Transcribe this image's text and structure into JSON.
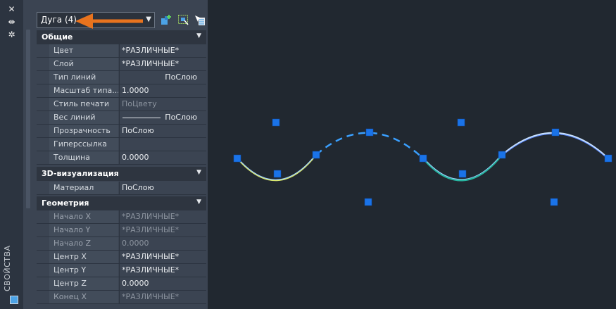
{
  "palette": {
    "vertical_title": "СВОЙСТВА",
    "selector_value": "Дуга (4)",
    "sections": {
      "general": "Общие",
      "visual3d": "3D-визуализация",
      "geometry": "Геометрия"
    },
    "general_rows": [
      {
        "name": "Цвет",
        "value": "*РАЗЛИЧНЫЕ*"
      },
      {
        "name": "Слой",
        "value": "*РАЗЛИЧНЫЕ*"
      },
      {
        "name": "Тип линий",
        "value": "ПоСлою"
      },
      {
        "name": "Масштаб типа...",
        "value": "1.0000"
      },
      {
        "name": "Стиль печати",
        "value": "ПоЦвету"
      },
      {
        "name": "Вес линий",
        "value": "ПоСлою"
      },
      {
        "name": "Прозрачность",
        "value": "ПоСлою"
      },
      {
        "name": "Гиперссылка",
        "value": ""
      },
      {
        "name": "Толщина",
        "value": "0.0000"
      }
    ],
    "visual_rows": [
      {
        "name": "Материал",
        "value": "ПоСлою"
      }
    ],
    "geometry_rows": [
      {
        "name": "Начало X",
        "value": "*РАЗЛИЧНЫЕ*"
      },
      {
        "name": "Начало Y",
        "value": "*РАЗЛИЧНЫЕ*"
      },
      {
        "name": "Начало Z",
        "value": "0.0000"
      },
      {
        "name": "Центр X",
        "value": "*РАЗЛИЧНЫЕ*"
      },
      {
        "name": "Центр Y",
        "value": "*РАЗЛИЧНЫЕ*"
      },
      {
        "name": "Центр Z",
        "value": "0.0000"
      },
      {
        "name": "Конец X",
        "value": "*РАЗЛИЧНЫЕ*"
      }
    ]
  },
  "icons": {
    "close": "close-icon",
    "autohide": "autohide-icon",
    "settings": "settings-icon",
    "quick_select": "quick-select-icon",
    "select_objects": "select-objects-icon",
    "pickadd": "pickadd-toggle-icon"
  },
  "colors": {
    "canvas_bg": "#212830",
    "grip": "#1a73e8",
    "annotation_arrow": "#e8731e",
    "arc_highlight": "#9fd0ff"
  }
}
